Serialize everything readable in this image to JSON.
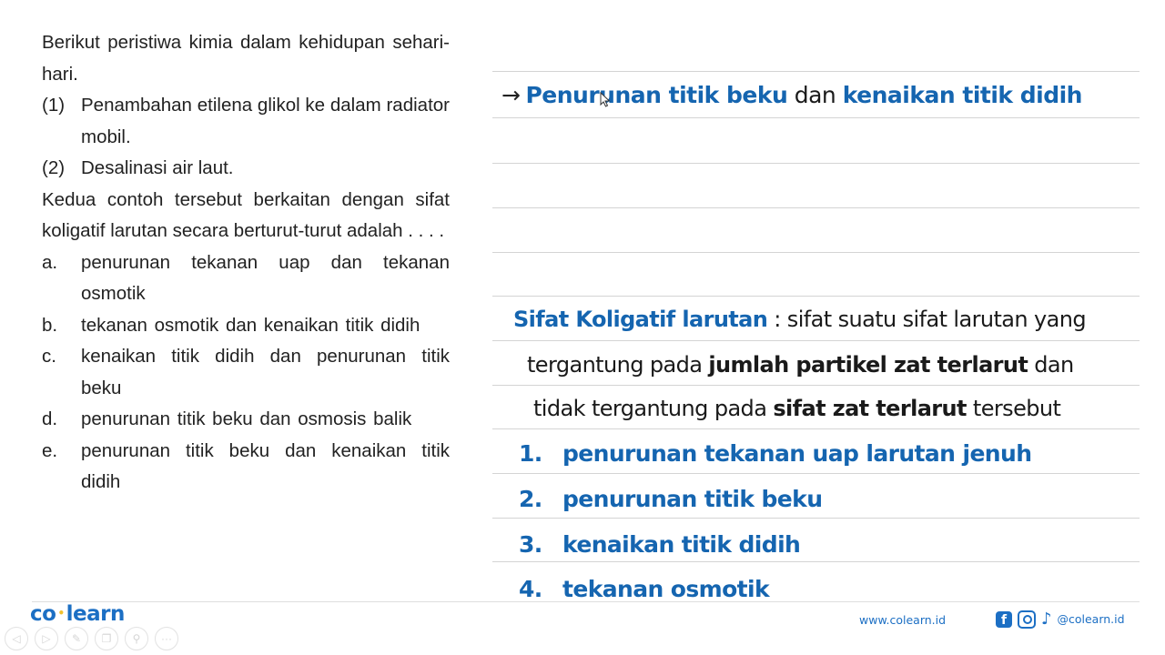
{
  "question": {
    "intro": "Berikut peristiwa kimia dalam kehidupan sehari-hari.",
    "items": [
      {
        "num": "(1)",
        "text": "Penambahan etilena glikol ke dalam radiator mobil."
      },
      {
        "num": "(2)",
        "text": "Desalinasi air laut."
      }
    ],
    "stem": "Kedua contoh tersebut berkaitan dengan sifat koligatif larutan secara berturut-turut adalah . . . .",
    "options": [
      {
        "letter": "a.",
        "text": "penurunan tekanan uap dan tekanan osmotik"
      },
      {
        "letter": "b.",
        "text": "tekanan osmotik dan kenaikan titik didih"
      },
      {
        "letter": "c.",
        "text": "kenaikan titik didih dan penurunan titik beku"
      },
      {
        "letter": "d.",
        "text": "penurunan titik beku dan osmosis balik"
      },
      {
        "letter": "e.",
        "text": "penurunan titik beku dan kenaikan titik didih"
      }
    ]
  },
  "notes": {
    "answer": {
      "arrow": "→",
      "part1": "Penurunan titik beku",
      "connector": " dan ",
      "part2": "kenaikan titik didih"
    },
    "definition": {
      "term": "Sifat Koligatif larutan",
      "line1_rest": " : sifat suatu sifat larutan yang",
      "line2_pre": "tergantung pada ",
      "line2_bold": "jumlah partikel zat terlarut",
      "line2_post": " dan",
      "line3_pre": "tidak tergantung pada ",
      "line3_bold": "sifat zat terlarut",
      "line3_post": " tersebut"
    },
    "list": [
      {
        "num": "1.",
        "text": "penurunan tekanan uap larutan jenuh"
      },
      {
        "num": "2.",
        "text": "penurunan titik beku"
      },
      {
        "num": "3.",
        "text": "kenaikan titik didih"
      },
      {
        "num": "4.",
        "text": "tekanan osmotik"
      }
    ]
  },
  "footer": {
    "logo_left": "co",
    "logo_dot": "•",
    "logo_right": "learn",
    "website": "www.colearn.id",
    "social_handle": "@colearn.id",
    "facebook_glyph": "f",
    "tiktok_glyph": "♪",
    "toolbar": [
      {
        "name": "prev-button",
        "icon": "◁"
      },
      {
        "name": "next-button",
        "icon": "▷"
      },
      {
        "name": "pen-button",
        "icon": "✎"
      },
      {
        "name": "copy-button",
        "icon": "❐"
      },
      {
        "name": "zoom-button",
        "icon": "⚲"
      },
      {
        "name": "more-button",
        "icon": "···"
      }
    ]
  },
  "colors": {
    "accent_blue": "#1565b0",
    "brand_blue": "#1c6fc4",
    "brand_yellow": "#f2c12e"
  }
}
